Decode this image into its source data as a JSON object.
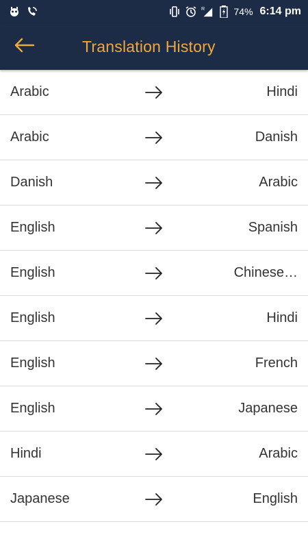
{
  "status_bar": {
    "battery": "74%",
    "time": "6:14 pm",
    "network_label": "R"
  },
  "app_bar": {
    "title": "Translation History",
    "title_color": "#f0a83a",
    "background_color": "#1c2b46"
  },
  "history": [
    {
      "from": "Arabic",
      "to": "Hindi"
    },
    {
      "from": "Arabic",
      "to": "Danish"
    },
    {
      "from": "Danish",
      "to": "Arabic"
    },
    {
      "from": "English",
      "to": "Spanish"
    },
    {
      "from": "English",
      "to": "Chinese…"
    },
    {
      "from": "English",
      "to": "Hindi"
    },
    {
      "from": "English",
      "to": "French"
    },
    {
      "from": "English",
      "to": "Japanese"
    },
    {
      "from": "Hindi",
      "to": "Arabic"
    },
    {
      "from": "Japanese",
      "to": "English"
    }
  ]
}
